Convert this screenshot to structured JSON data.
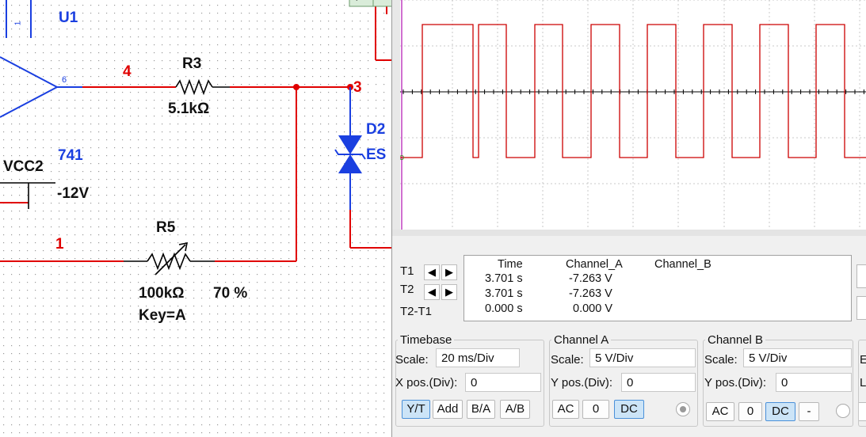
{
  "schematic": {
    "u1_label": "U1",
    "opamp_pin_label": "6",
    "opamp_model": "741",
    "pin_small_label": "1",
    "node4": "4",
    "node3": "3",
    "node1": "1",
    "r3_name": "R3",
    "r3_value": "5.1kΩ",
    "r5_name": "R5",
    "r5_value": "100kΩ",
    "r5_percent": "70 %",
    "r5_key": "Key=A",
    "vcc_name": "VCC2",
    "vcc_value": "-12V",
    "d2_name": "D2",
    "d2_model": "ES",
    "top_plus": "+",
    "top_minus": "−",
    "wire_color": "#e00000",
    "component_color": "#1a3fe0"
  },
  "scope": {
    "trace_color": "#cc0000",
    "cursor_color": "#c040c0",
    "cursors": {
      "t1_label": "T1",
      "t2_label": "T2",
      "diff_label": "T2-T1",
      "left_arrow": "◀",
      "right_arrow": "▶"
    },
    "readout": {
      "headers": [
        "Time",
        "Channel_A",
        "Channel_B"
      ],
      "rows": [
        [
          "3.701 s",
          "-7.263 V",
          ""
        ],
        [
          "3.701 s",
          "-7.263 V",
          ""
        ],
        [
          "0.000 s",
          "0.000 V",
          ""
        ]
      ]
    },
    "timebase": {
      "title": "Timebase",
      "scale_label": "Scale:",
      "scale_value": "20 ms/Div",
      "pos_label": "X pos.(Div):",
      "pos_value": "0",
      "buttons": [
        "Y/T",
        "Add",
        "B/A",
        "A/B"
      ],
      "active": "Y/T"
    },
    "channel_a": {
      "title": "Channel A",
      "scale_label": "Scale:",
      "scale_value": "5  V/Div",
      "pos_label": "Y pos.(Div):",
      "pos_value": "0",
      "ac_label": "AC",
      "zero_label": "0",
      "dc_label": "DC"
    },
    "channel_b": {
      "title": "Channel B",
      "scale_label": "Scale:",
      "scale_value": "5  V/Div",
      "pos_label": "Y pos.(Div):",
      "pos_value": "0",
      "ac_label": "AC",
      "zero_label": "0",
      "dc_label": "DC",
      "minus_label": "-"
    },
    "trigger_partial": {
      "edge_letter": "E",
      "level_letter": "L"
    }
  }
}
